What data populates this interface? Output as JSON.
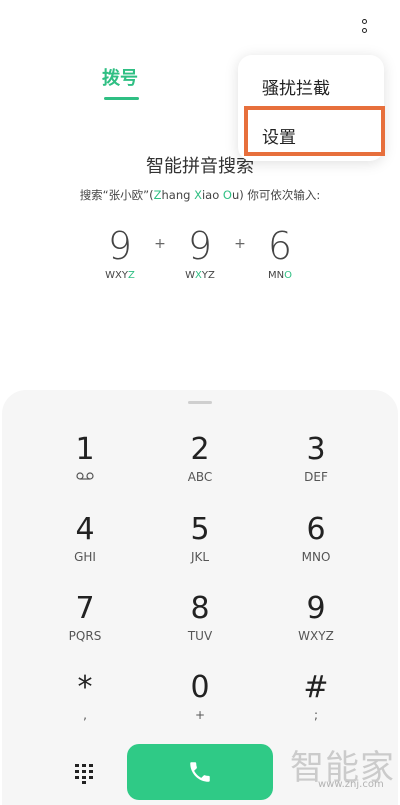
{
  "header": {
    "tab_dial": "拨号",
    "more_icon": "more-vertical-icon"
  },
  "menu": {
    "block_label": "骚扰拦截",
    "settings_label": "设置"
  },
  "hint": {
    "title": "智能拼音搜索",
    "sub_prefix": "搜索“张小欧”(",
    "sub_z": "Z",
    "sub_hang": "hang ",
    "sub_x": "X",
    "sub_iao": "iao ",
    "sub_o": "O",
    "sub_u": "u",
    "sub_suffix": ") 你可依次输入:"
  },
  "example": {
    "d1": "9",
    "d2": "9",
    "d3": "6",
    "plus": "+",
    "l1_pre": "WXY",
    "l1_hl": "Z",
    "l2_pre": "W",
    "l2_hl": "X",
    "l2_post": "YZ",
    "l3_pre": "MN",
    "l3_hl": "O"
  },
  "keys": [
    {
      "digit": "1",
      "sub": ""
    },
    {
      "digit": "2",
      "sub": "ABC"
    },
    {
      "digit": "3",
      "sub": "DEF"
    },
    {
      "digit": "4",
      "sub": "GHI"
    },
    {
      "digit": "5",
      "sub": "JKL"
    },
    {
      "digit": "6",
      "sub": "MNO"
    },
    {
      "digit": "7",
      "sub": "PQRS"
    },
    {
      "digit": "8",
      "sub": "TUV"
    },
    {
      "digit": "9",
      "sub": "WXYZ"
    },
    {
      "digit": "*",
      "sub": ","
    },
    {
      "digit": "0",
      "sub": "+"
    },
    {
      "digit": "#",
      "sub": ";"
    }
  ],
  "footer": {
    "dialpad_icon": "dialpad-icon",
    "call_icon": "phone-icon"
  },
  "watermark": {
    "text": "智能家",
    "url": "www.znj.com"
  },
  "colors": {
    "accent": "#2fbf83",
    "call": "#2fca86",
    "highlight_box": "#e76f3c"
  }
}
